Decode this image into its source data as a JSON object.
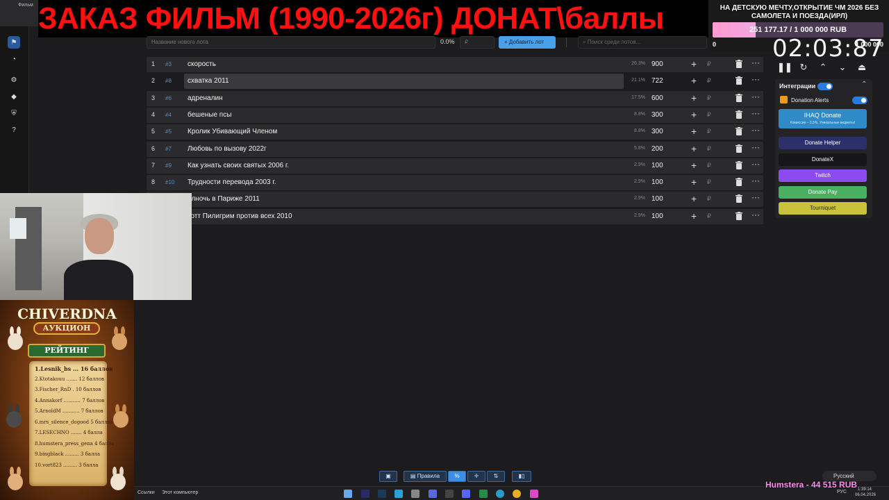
{
  "browser": {
    "tab_title": "Фильм"
  },
  "banner": {
    "text": "ЗАКАЗ ФИЛЬМ (1990-2026г) ДОНАТ\\баллы"
  },
  "goal": {
    "title": "НА ДЕТСКУЮ МЕЧТУ,ОТКРЫТИЕ ЧМ 2026 БЕЗ САМОЛЕТА И ПОЕЗДА(ИРЛ)",
    "progress_text": "251 177.17 / 1 000 000 RUB",
    "progress_fraction": 0.251,
    "min": "0",
    "max": "1 000 000"
  },
  "timer": "02:03:87",
  "toolbar": {
    "lot_name_placeholder": "Название нового лота",
    "percent": "0.0%",
    "amount_placeholder": "₽",
    "add_label": "Добавить лот",
    "search_placeholder": "Поиск среди лотов..."
  },
  "lots": [
    {
      "num": "1",
      "id": "#3",
      "name": "скорость",
      "pct": "26.3%",
      "amount": "900"
    },
    {
      "num": "2",
      "id": "#8",
      "name": "схватка 2011",
      "pct": "21.1%",
      "amount": "722"
    },
    {
      "num": "3",
      "id": "#6",
      "name": "адреналин",
      "pct": "17.5%",
      "amount": "600"
    },
    {
      "num": "4",
      "id": "#4",
      "name": "бешеные псы",
      "pct": "8.8%",
      "amount": "300"
    },
    {
      "num": "5",
      "id": "#5",
      "name": "Кролик Убивающий Членом",
      "pct": "8.8%",
      "amount": "300"
    },
    {
      "num": "6",
      "id": "#7",
      "name": "Любовь по вызову 2022г",
      "pct": "5.8%",
      "amount": "200"
    },
    {
      "num": "7",
      "id": "#9",
      "name": "Как узнать своих святых 2006 г.",
      "pct": "2.9%",
      "amount": "100"
    },
    {
      "num": "8",
      "id": "#10",
      "name": "Трудности перевода 2003 г.",
      "pct": "2.9%",
      "amount": "100"
    },
    {
      "num": "",
      "id": "",
      "name": "олночь в Париже 2011",
      "pct": "2.9%",
      "amount": "100"
    },
    {
      "num": "",
      "id": "",
      "name": "котт Пилигрим против всех 2010",
      "pct": "2.9%",
      "amount": "100"
    }
  ],
  "lot_row": {
    "plus": "+",
    "rub": "₽",
    "more": "···"
  },
  "panel": {
    "integrations_label": "Интеграции",
    "donation_alerts_label": "Donation Alerts",
    "ihaq_title": "IHAQ Donate",
    "ihaq_sub": "Комиссия – 3,5%. Уникальные виджеты!",
    "buttons": [
      {
        "label": "Donate Helper",
        "color": "#2b2f6a"
      },
      {
        "label": "DonateX",
        "color": "#15151a"
      },
      {
        "label": "Twitch",
        "color": "#8a4cf0"
      },
      {
        "label": "Donate Pay",
        "color": "#48b060"
      },
      {
        "label": "Tourniquet",
        "color": "#c9c23a"
      }
    ]
  },
  "poster": {
    "title": "CHIVERDNA",
    "subtitle": "АУКЦИОН",
    "rank_title": "РЕЙТИНГ",
    "rows": [
      "1.Lesnik_bs ... 16 баллов",
      "2.Ktotakouu ....... 12 баллов",
      "3.Fischer_RnD . 10 баллов",
      "4.Annakorf ........... 7 баллов",
      "5.ArnoldM ........... 7 баллов",
      "6.mrs_silence_dogood 5 баллов",
      "7.LESECHNO ....... 4 балла",
      "8.humstera_press_gena 4 балла",
      "9.bingblack ......... 3 балла",
      "10.vort823 ......... 3 балла"
    ]
  },
  "bottom_tools": {
    "rules_label": "Правила"
  },
  "taskbar": {
    "links_label": "Ссылки",
    "computer_label": "Этот компьютер",
    "time": "1:39:14",
    "date": "06.04.2026",
    "lang": "РУС"
  },
  "overlay": {
    "humstera": "Humstera - 44 515 RUB",
    "language": "Русский"
  }
}
